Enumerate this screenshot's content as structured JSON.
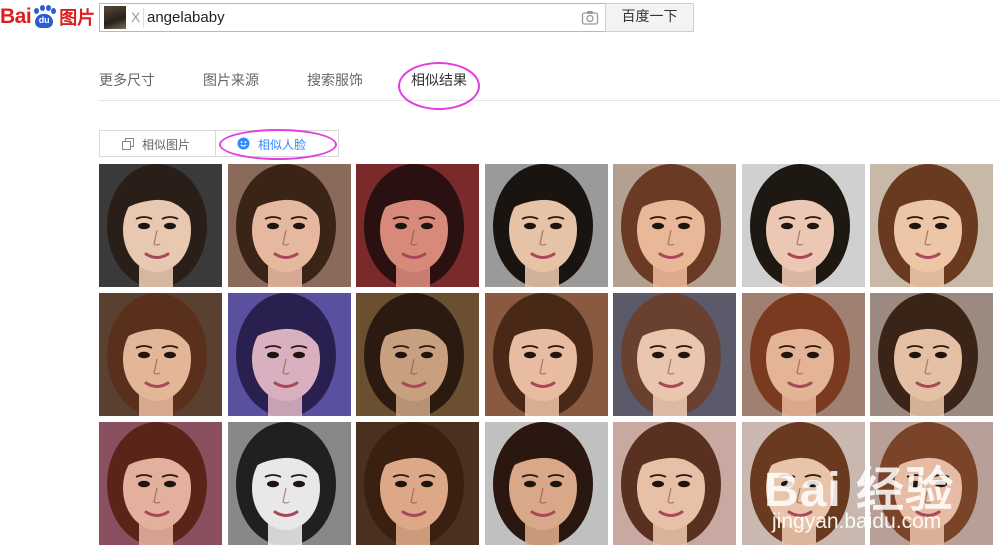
{
  "logo": {
    "brand": "Bai",
    "paw": "du",
    "product": "图片"
  },
  "search": {
    "query": "angelababy",
    "clear": "X",
    "button": "百度一下"
  },
  "tabs": [
    "更多尺寸",
    "图片来源",
    "搜索服饰",
    "相似结果"
  ],
  "toggle": {
    "option1": "相似图片",
    "option2": "相似人脸"
  },
  "colors": {
    "brand_red": "#de1d1d",
    "brand_blue": "#2a5cd6",
    "active_blue": "#3388ff",
    "highlight": "#e23de0"
  },
  "icons": {
    "camera": "camera-icon",
    "copy": "copy-icon",
    "face": "face-icon"
  },
  "results": [
    {
      "row": 0,
      "col": 0
    },
    {
      "row": 0,
      "col": 1
    },
    {
      "row": 0,
      "col": 2
    },
    {
      "row": 0,
      "col": 3
    },
    {
      "row": 0,
      "col": 4
    },
    {
      "row": 0,
      "col": 5
    },
    {
      "row": 0,
      "col": 6
    },
    {
      "row": 1,
      "col": 0
    },
    {
      "row": 1,
      "col": 1
    },
    {
      "row": 1,
      "col": 2
    },
    {
      "row": 1,
      "col": 3
    },
    {
      "row": 1,
      "col": 4
    },
    {
      "row": 1,
      "col": 5
    },
    {
      "row": 1,
      "col": 6
    },
    {
      "row": 2,
      "col": 0
    },
    {
      "row": 2,
      "col": 1
    },
    {
      "row": 2,
      "col": 2
    },
    {
      "row": 2,
      "col": 3
    },
    {
      "row": 2,
      "col": 4
    },
    {
      "row": 2,
      "col": 5
    },
    {
      "row": 2,
      "col": 6
    }
  ],
  "watermark": {
    "brand": "Bai  经验",
    "site": "jingyan.baidu.com"
  }
}
